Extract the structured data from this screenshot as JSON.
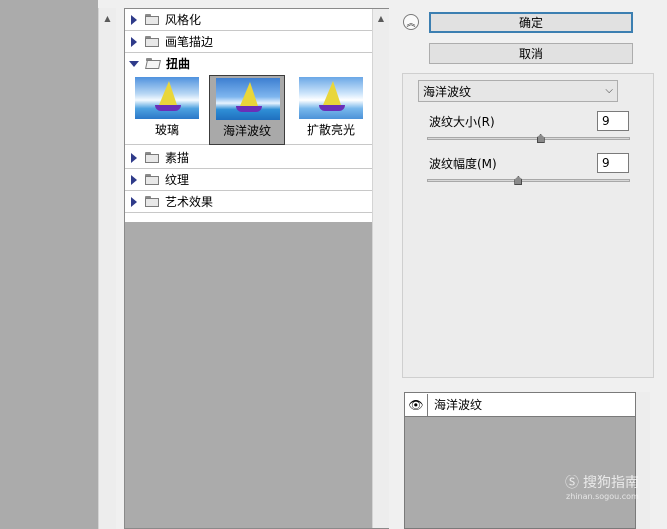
{
  "tree": {
    "categories_top": [
      {
        "label": "风格化"
      },
      {
        "label": "画笔描边"
      },
      {
        "label": "扭曲"
      }
    ],
    "thumbnails": [
      {
        "label": "玻璃"
      },
      {
        "label": "海洋波纹"
      },
      {
        "label": "扩散亮光"
      }
    ],
    "categories_bottom": [
      {
        "label": "素描"
      },
      {
        "label": "纹理"
      },
      {
        "label": "艺术效果"
      }
    ]
  },
  "buttons": {
    "ok": "确定",
    "cancel": "取消"
  },
  "settings": {
    "selected_filter": "海洋波纹",
    "params": [
      {
        "label": "波纹大小(R)",
        "value": "9",
        "slider_fraction": 0.56
      },
      {
        "label": "波纹幅度(M)",
        "value": "9",
        "slider_fraction": 0.45
      }
    ]
  },
  "layers": {
    "name": "海洋波纹"
  },
  "watermark": {
    "text": "搜狗指南",
    "sub": "zhinan.sogou.com"
  },
  "icons": {
    "collapse": "double-chevron-up-icon",
    "eye": "eye-icon",
    "folder": "folder-icon"
  }
}
